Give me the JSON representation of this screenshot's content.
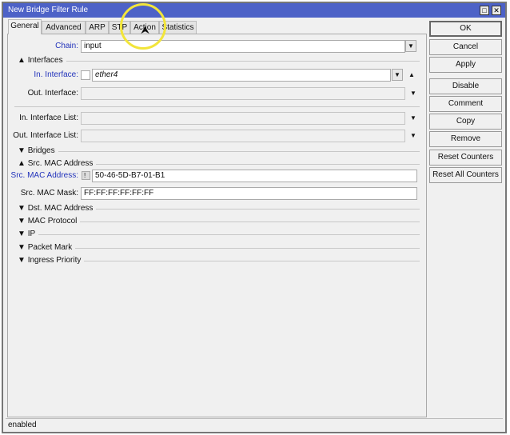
{
  "window": {
    "title": "New Bridge Filter Rule",
    "maximize_icon": "maximize-icon",
    "close_icon": "close-icon"
  },
  "tabs": [
    "General",
    "Advanced",
    "ARP",
    "STP",
    "Action",
    "Statistics"
  ],
  "active_tab": "General",
  "form": {
    "chain": {
      "label": "Chain:",
      "value": "input"
    },
    "interfaces_section": "Interfaces",
    "in_interface": {
      "label": "In. Interface:",
      "value": "ether4",
      "negate": false
    },
    "out_interface": {
      "label": "Out. Interface:",
      "value": ""
    },
    "in_interface_list": {
      "label": "In. Interface List:",
      "value": ""
    },
    "out_interface_list": {
      "label": "Out. Interface List:",
      "value": ""
    },
    "bridges_section": "Bridges",
    "src_mac_section": "Src. MAC Address",
    "src_mac_address": {
      "label": "Src. MAC Address:",
      "value": "50-46-5D-B7-01-B1",
      "negate_marker": "!"
    },
    "src_mac_mask": {
      "label": "Src. MAC Mask:",
      "value": "FF:FF:FF:FF:FF:FF"
    },
    "dst_mac_section": "Dst. MAC Address",
    "mac_protocol_section": "MAC Protocol",
    "ip_section": "IP",
    "packet_mark_section": "Packet Mark",
    "ingress_priority_section": "Ingress Priority"
  },
  "buttons": [
    "OK",
    "Cancel",
    "Apply",
    "Disable",
    "Comment",
    "Copy",
    "Remove",
    "Reset Counters",
    "Reset All Counters"
  ],
  "status": "enabled",
  "colors": {
    "titlebar": "#4d62c7",
    "highlight": "#f2e53a",
    "label_active": "#2233bb"
  }
}
